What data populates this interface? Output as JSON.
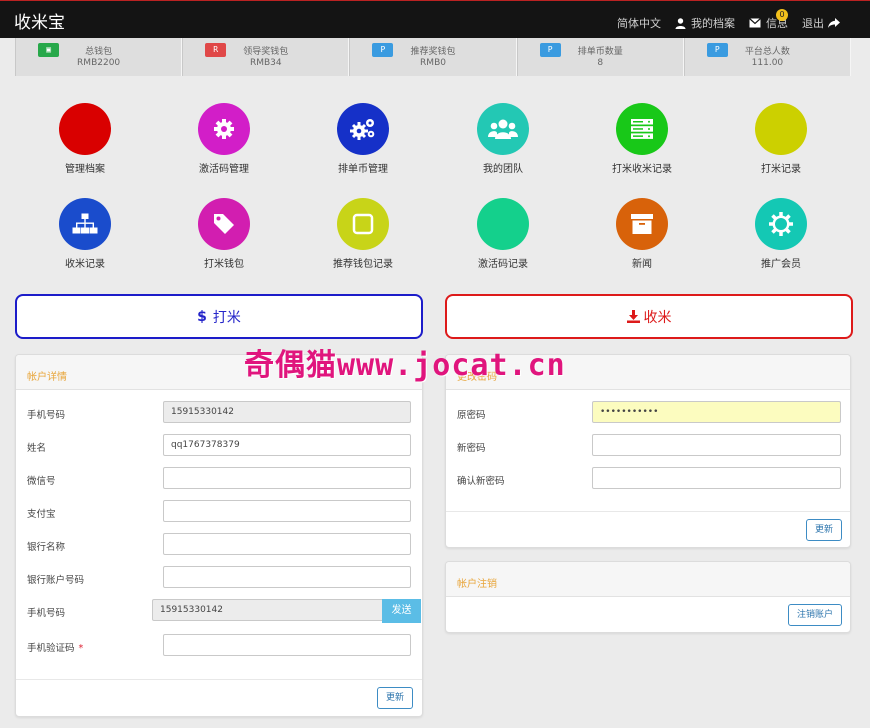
{
  "app": {
    "title": "收米宝"
  },
  "topnav": {
    "language": "简体中文",
    "profile": "我的档案",
    "messages": "信息",
    "message_count": "0",
    "logout": "退出"
  },
  "stats": [
    {
      "label": "总钱包",
      "value": "RMB2200",
      "icon_color": "#27a84a"
    },
    {
      "label": "领导奖钱包",
      "value": "RMB34",
      "icon_color": "#e04848"
    },
    {
      "label": "推荐奖钱包",
      "value": "RMB0",
      "icon_color": "#3a9be0"
    },
    {
      "label": "排单币数量",
      "value": "8",
      "icon_color": "#3a9be0"
    },
    {
      "label": "平台总人数",
      "value": "111.00",
      "icon_color": "#3a9be0"
    }
  ],
  "tiles": [
    {
      "label": "管理档案",
      "color": "#d90000",
      "icon": "none"
    },
    {
      "label": "激活码管理",
      "color": "#d21ec8",
      "icon": "gear-icon"
    },
    {
      "label": "排单币管理",
      "color": "#1530c8",
      "icon": "gears-icon"
    },
    {
      "label": "我的团队",
      "color": "#23c8b4",
      "icon": "users-icon"
    },
    {
      "label": "打米收米记录",
      "color": "#18c818",
      "icon": "server-icon"
    },
    {
      "label": "打米记录",
      "color": "#ccd000",
      "icon": "none"
    },
    {
      "label": "收米记录",
      "color": "#1a4ccc",
      "icon": "sitemap-icon"
    },
    {
      "label": "打米钱包",
      "color": "#d21eb0",
      "icon": "tag-icon"
    },
    {
      "label": "推荐钱包记录",
      "color": "#c8d418",
      "icon": "square-icon"
    },
    {
      "label": "激活码记录",
      "color": "#14d08c",
      "icon": "none"
    },
    {
      "label": "新闻",
      "color": "#d8620a",
      "icon": "archive-icon"
    },
    {
      "label": "推广会员",
      "color": "#14c8b4",
      "icon": "cog-icon"
    }
  ],
  "actions": {
    "send_label": "打米",
    "send_icon": "$",
    "receive_label": "收米",
    "brand_blue": "#1c1cc9",
    "brand_red": "#dd1a1a"
  },
  "account_panel": {
    "title": "帐户详情",
    "fields": [
      {
        "label": "手机号码",
        "value": "15915330142",
        "readonly": true
      },
      {
        "label": "姓名",
        "value": "qq1767378379"
      },
      {
        "label": "微信号",
        "value": ""
      },
      {
        "label": "支付宝",
        "value": ""
      },
      {
        "label": "银行名称",
        "value": ""
      },
      {
        "label": "银行账户号码",
        "value": ""
      }
    ],
    "phone_label": "手机号码",
    "phone_value": "15915330142",
    "send_label": "发送",
    "code_label": "手机验证码",
    "required_mark": "*",
    "update_label": "更新"
  },
  "password_panel": {
    "title": "更改密码",
    "fields": [
      {
        "label": "原密码",
        "value": "•••••••••••"
      },
      {
        "label": "新密码",
        "value": ""
      },
      {
        "label": "确认新密码",
        "value": ""
      }
    ],
    "update_label": "更新"
  },
  "cancel_panel": {
    "title": "帐户注销",
    "button_label": "注销账户"
  },
  "watermark": "奇偶猫www.jocat.cn"
}
